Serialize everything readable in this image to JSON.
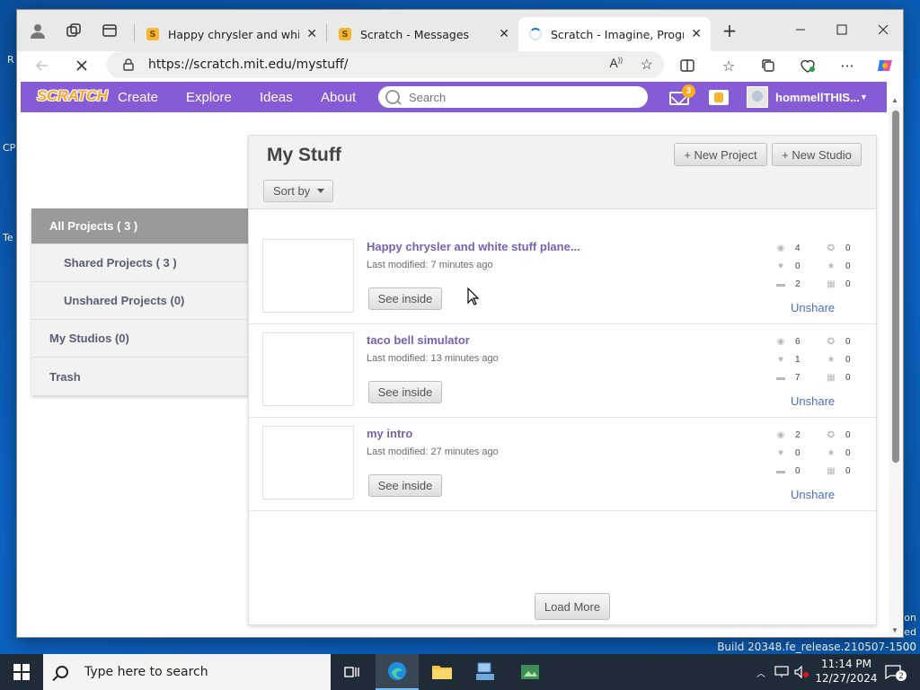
{
  "desktop": {
    "left_glyphs": [
      "R",
      "CP",
      "Te"
    ],
    "right_glyphs": [
      "on",
      "ed"
    ],
    "build_text": "Build 20348.fe_release.210507-1500"
  },
  "browser": {
    "tabs": [
      {
        "title": "Happy chrysler and white stu",
        "active": false
      },
      {
        "title": "Scratch - Messages",
        "active": false
      },
      {
        "title": "Scratch - Imagine, Program,",
        "active": true
      }
    ],
    "url": "https://scratch.mit.edu/mystuff/"
  },
  "scratch_nav": {
    "logo": "SCRATCH",
    "links": [
      "Create",
      "Explore",
      "Ideas",
      "About"
    ],
    "search_placeholder": "Search",
    "message_count": "3",
    "username": "hommellTHIS..."
  },
  "sidebar": {
    "items": [
      {
        "label": "All Projects ( 3 )",
        "active": true
      },
      {
        "label": "Shared Projects ( 3 )",
        "active": false
      },
      {
        "label": "Unshared Projects (0)",
        "active": false
      },
      {
        "label": "My Studios (0)",
        "active": false
      },
      {
        "label": "Trash",
        "active": false
      }
    ]
  },
  "main": {
    "title": "My Stuff",
    "new_project": "+ New Project",
    "new_studio": "+ New Studio",
    "sort_by": "Sort by",
    "see_inside": "See inside",
    "unshare": "Unshare",
    "load_more": "Load More",
    "projects": [
      {
        "title": "Happy chrysler and white stuff plane...",
        "modified": "Last modified: 7 minutes ago",
        "views": "4",
        "loves": "0",
        "comments": "2",
        "remixes": "0",
        "favorites": "0",
        "studios": "0"
      },
      {
        "title": "taco bell simulator",
        "modified": "Last modified: 13 minutes ago",
        "views": "6",
        "loves": "1",
        "comments": "7",
        "remixes": "0",
        "favorites": "0",
        "studios": "0"
      },
      {
        "title": "my intro",
        "modified": "Last modified: 27 minutes ago",
        "views": "2",
        "loves": "0",
        "comments": "0",
        "remixes": "0",
        "favorites": "0",
        "studios": "0"
      }
    ]
  },
  "taskbar": {
    "search_text": "Type here to search",
    "time": "11:14 PM",
    "date": "12/27/2024",
    "notification_count": "2"
  }
}
